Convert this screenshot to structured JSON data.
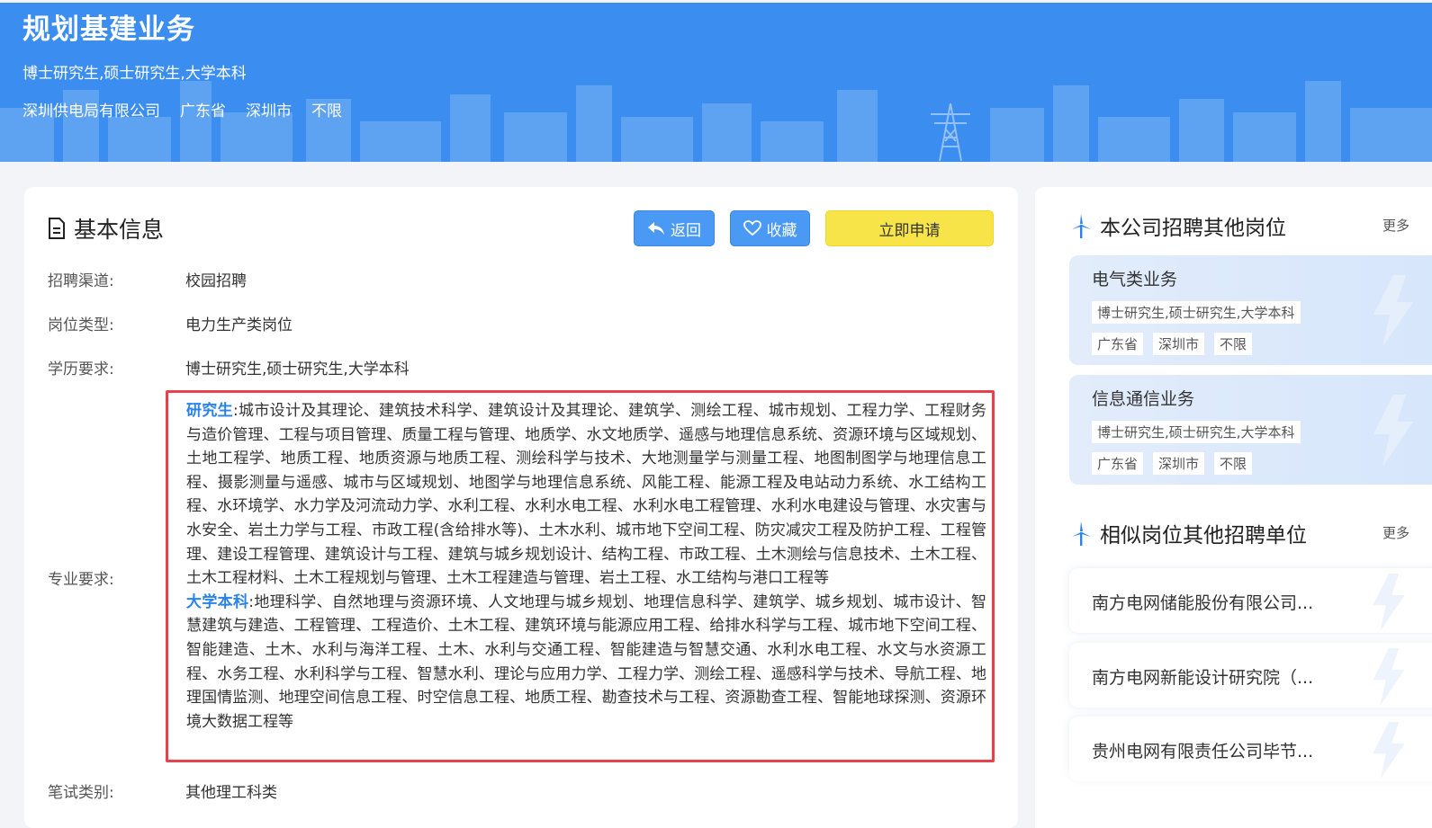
{
  "banner": {
    "title": "规划基建业务",
    "education": "博士研究生,硕士研究生,大学本科",
    "company": "深圳供电局有限公司",
    "province": "广东省",
    "city": "深圳市",
    "other": "不限"
  },
  "basic": {
    "title": "基本信息",
    "back_label": "返回",
    "fav_label": "收藏",
    "apply_label": "立即申请",
    "rows": [
      {
        "label": "招聘渠道:",
        "value": "校园招聘"
      },
      {
        "label": "岗位类型:",
        "value": "电力生产类岗位"
      },
      {
        "label": "学历要求:",
        "value": "博士研究生,硕士研究生,大学本科"
      },
      {
        "label": "专业要求:",
        "value": ""
      },
      {
        "label": "笔试类别:",
        "value": "其他理工科类"
      }
    ],
    "major": {
      "grad_tag": "研究生",
      "grad_text": ":城市设计及其理论、建筑技术科学、建筑设计及其理论、建筑学、测绘工程、城市规划、工程力学、工程财务与造价管理、工程与项目管理、质量工程与管理、地质学、水文地质学、遥感与地理信息系统、资源环境与区域规划、土地工程学、地质工程、地质资源与地质工程、测绘科学与技术、大地测量学与测量工程、地图制图学与地理信息工程、摄影测量与遥感、城市与区域规划、地图学与地理信息系统、风能工程、能源工程及电站动力系统、水工结构工程、水环境学、水力学及河流动力学、水利工程、水利水电工程、水利水电工程管理、水利水电建设与管理、水灾害与水安全、岩土力学与工程、市政工程(含给排水等)、土木水利、城市地下空间工程、防灾减灾工程及防护工程、工程管理、建设工程管理、建筑设计与工程、建筑与城乡规划设计、结构工程、市政工程、土木测绘与信息技术、土木工程、土木工程材料、土木工程规划与管理、土木工程建造与管理、岩土工程、水工结构与港口工程等",
      "ug_tag": "大学本科",
      "ug_text": ":地理科学、自然地理与资源环境、人文地理与城乡规划、地理信息科学、建筑学、城乡规划、城市设计、智慧建筑与建造、工程管理、工程造价、土木工程、建筑环境与能源应用工程、给排水科学与工程、城市地下空间工程、智能建造、土木、水利与海洋工程、土木、水利与交通工程、智能建造与智慧交通、水利水电工程、水文与水资源工程、水务工程、水利科学与工程、智慧水利、理论与应用力学、工程力学、测绘工程、遥感科学与技术、导航工程、地理国情监测、地理空间信息工程、时空信息工程、地质工程、勘查技术与工程、资源勘查工程、智能地球探测、资源环境大数据工程等"
    }
  },
  "sidebar": {
    "other_jobs_title": "本公司招聘其他岗位",
    "similar_title": "相似岗位其他招聘单位",
    "more_label": "更多",
    "jobs": [
      {
        "title": "电气类业务",
        "education": "博士研究生,硕士研究生,大学本科",
        "province": "广东省",
        "city": "深圳市",
        "other": "不限"
      },
      {
        "title": "信息通信业务",
        "education": "博士研究生,硕士研究生,大学本科",
        "province": "广东省",
        "city": "深圳市",
        "other": "不限"
      }
    ],
    "companies": [
      {
        "name": "南方电网储能股份有限公司..."
      },
      {
        "name": "南方电网新能设计研究院（..."
      },
      {
        "name": "贵州电网有限责任公司毕节..."
      }
    ]
  },
  "colors": {
    "banner": "#3b8ef0",
    "button_blue": "#4a9af5",
    "button_yellow": "#f7e448",
    "highlight_border": "#e5424d",
    "tag_blue": "#2a83e8"
  }
}
